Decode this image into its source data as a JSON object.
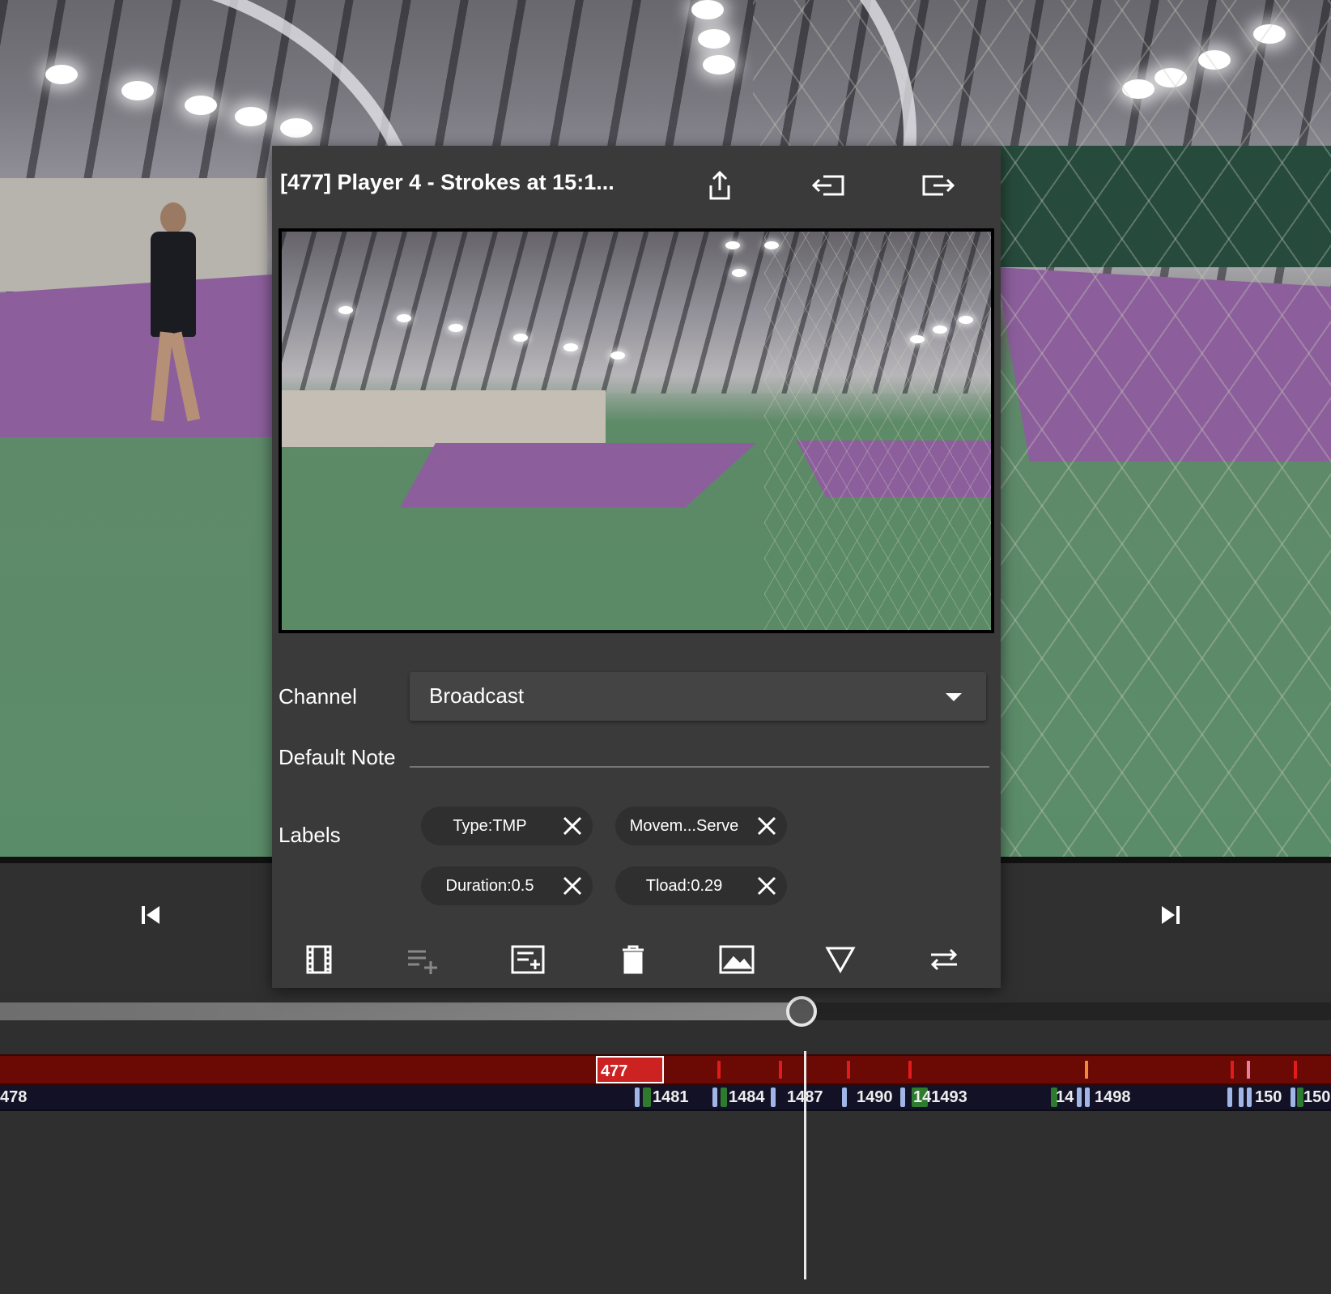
{
  "clip_panel": {
    "title": "[477] Player 4 - Strokes at 15:1...",
    "header_icons": [
      "share-icon",
      "exit-left-icon",
      "exit-right-icon"
    ],
    "channel": {
      "label": "Channel",
      "value": "Broadcast"
    },
    "default_note": {
      "label": "Default Note",
      "value": "",
      "placeholder": ""
    },
    "labels": {
      "label": "Labels",
      "chips": [
        "Type:TMP",
        "Movem...Serve",
        "Duration:0.5",
        "Tload:0.29"
      ]
    },
    "toolbar_icons": [
      "film-icon",
      "playlist-add-icon",
      "add-note-icon",
      "trash-icon",
      "image-icon",
      "triangle-down-icon",
      "swap-icon"
    ]
  },
  "player_controls": {
    "icons": [
      "skip-previous-icon",
      "skip-next-icon"
    ],
    "progress": 0.6
  },
  "timeline": {
    "event_track": {
      "selected_clip_label": "477"
    },
    "id_track": {
      "labels": [
        "478",
        "1481",
        "1484",
        "1487",
        "1490",
        "141493",
        "14",
        "1498",
        "150",
        "150"
      ]
    }
  },
  "colors": {
    "panel_bg": "#3a3a3a",
    "event_track": "#6b0a05",
    "event_marker": "#e21b1b",
    "id_track": "#131126",
    "chip_bg": "#2f2f2f"
  }
}
